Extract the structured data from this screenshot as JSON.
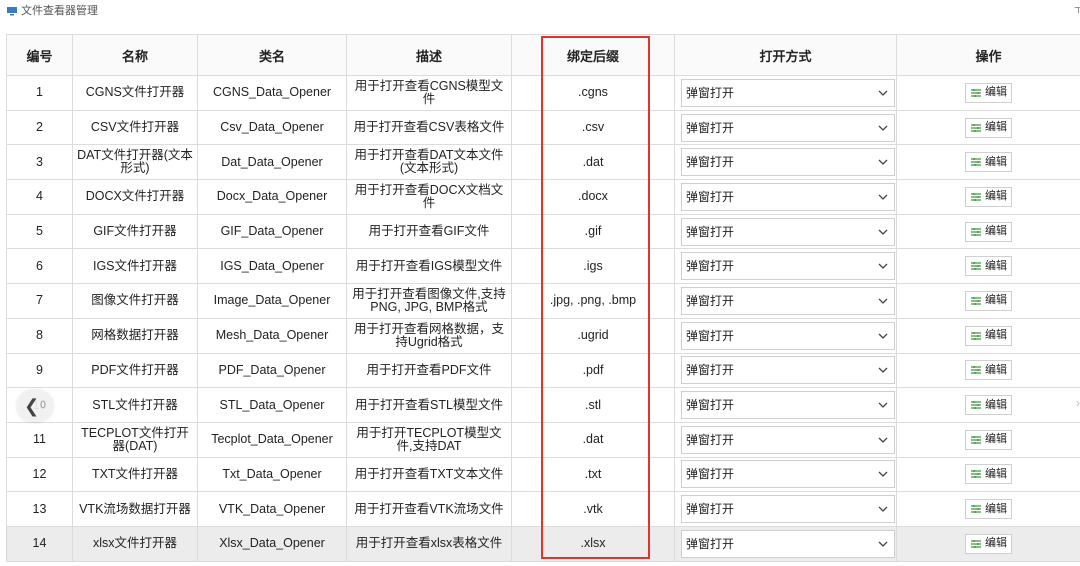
{
  "window": {
    "title": "文件查看器管理",
    "corner": "ד",
    "icon": "viewer-window-icon",
    "accent_color": "#e33232"
  },
  "table": {
    "headers": {
      "id": "编号",
      "name": "名称",
      "class_name": "类名",
      "description": "描述",
      "suffix": "绑定后缀",
      "open_mode": "打开方式",
      "actions": "操作"
    },
    "edit_label": "编辑",
    "rows": [
      {
        "id": "1",
        "name": "CGNS文件打开器",
        "class_name": "CGNS_Data_Opener",
        "description": "用于打开查看CGNS模型文件",
        "suffix": ".cgns",
        "open_mode": "弹窗打开"
      },
      {
        "id": "2",
        "name": "CSV文件打开器",
        "class_name": "Csv_Data_Opener",
        "description": "用于打开查看CSV表格文件",
        "suffix": ".csv",
        "open_mode": "弹窗打开"
      },
      {
        "id": "3",
        "name": "DAT文件打开器(文本形式)",
        "class_name": "Dat_Data_Opener",
        "description": "用于打开查看DAT文本文件(文本形式)",
        "suffix": ".dat",
        "open_mode": "弹窗打开"
      },
      {
        "id": "4",
        "name": "DOCX文件打开器",
        "class_name": "Docx_Data_Opener",
        "description": "用于打开查看DOCX文档文件",
        "suffix": ".docx",
        "open_mode": "弹窗打开"
      },
      {
        "id": "5",
        "name": "GIF文件打开器",
        "class_name": "GIF_Data_Opener",
        "description": "用于打开查看GIF文件",
        "suffix": ".gif",
        "open_mode": "弹窗打开"
      },
      {
        "id": "6",
        "name": "IGS文件打开器",
        "class_name": "IGS_Data_Opener",
        "description": "用于打开查看IGS模型文件",
        "suffix": ".igs",
        "open_mode": "弹窗打开"
      },
      {
        "id": "7",
        "name": "图像文件打开器",
        "class_name": "Image_Data_Opener",
        "description": "用于打开查看图像文件,支持PNG, JPG, BMP格式",
        "suffix": ".jpg, .png, .bmp",
        "open_mode": "弹窗打开"
      },
      {
        "id": "8",
        "name": "网格数据打开器",
        "class_name": "Mesh_Data_Opener",
        "description": "用于打开查看网格数据，支持Ugrid格式",
        "suffix": ".ugrid",
        "open_mode": "弹窗打开"
      },
      {
        "id": "9",
        "name": "PDF文件打开器",
        "class_name": "PDF_Data_Opener",
        "description": "用于打开查看PDF文件",
        "suffix": ".pdf",
        "open_mode": "弹窗打开"
      },
      {
        "id": "10",
        "name": "STL文件打开器",
        "class_name": "STL_Data_Opener",
        "description": "用于打开查看STL模型文件",
        "suffix": ".stl",
        "open_mode": "弹窗打开"
      },
      {
        "id": "11",
        "name": "TECPLOT文件打开器(DAT)",
        "class_name": "Tecplot_Data_Opener",
        "description": "用于打开TECPLOT模型文件,支持DAT",
        "suffix": ".dat",
        "open_mode": "弹窗打开"
      },
      {
        "id": "12",
        "name": "TXT文件打开器",
        "class_name": "Txt_Data_Opener",
        "description": "用于打开查看TXT文本文件",
        "suffix": ".txt",
        "open_mode": "弹窗打开"
      },
      {
        "id": "13",
        "name": "VTK流场数据打开器",
        "class_name": "VTK_Data_Opener",
        "description": "用于打开查看VTK流场文件",
        "suffix": ".vtk",
        "open_mode": "弹窗打开"
      },
      {
        "id": "14",
        "name": "xlsx文件打开器",
        "class_name": "Xlsx_Data_Opener",
        "description": "用于打开查看xlsx表格文件",
        "suffix": ".xlsx",
        "open_mode": "弹窗打开"
      }
    ]
  },
  "overlay": {
    "prev_glyph": "❮",
    "prev_count": "0",
    "next_glyph": "›"
  }
}
